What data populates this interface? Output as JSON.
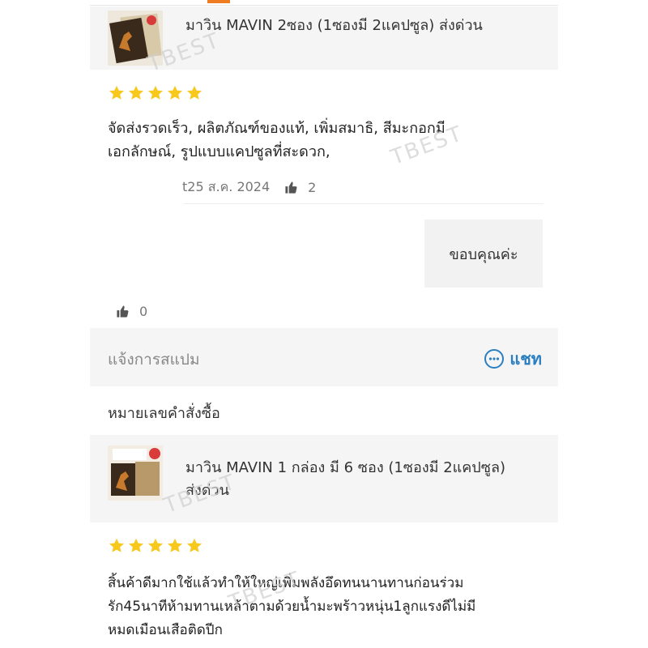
{
  "reviews": [
    {
      "product_title": "มาวิน MAVIN 2ซอง (1ซองมี 2แคปซูล) ส่งด่วน",
      "rating": 5,
      "text_lines": [
        "จัดส่งรวดเร็ว, ผลิตภัณฑ์ของแท้, เพิ่มสมาธิ, สีมะกอกมี",
        "เอกลักษณ์, รูปแบบแคปซูลที่สะดวก,"
      ],
      "date": "t25 ส.ค. 2024",
      "likes": "2",
      "seller_reply": "ขอบคุณค่ะ",
      "reply_likes": "0"
    },
    {
      "product_title_lines": [
        "มาวิน MAVIN 1 กล่อง มี 6 ซอง (1ซองมี 2แคปซูล)",
        "ส่งด่วน"
      ],
      "rating": 5,
      "text_lines": [
        "สิ้นค้าดีมากใช้แล้วทำให้ใหญ่เพิ่มพลังอึดทนนานทานก่อนร่วม",
        "รัก45นาทีห้ามทานเหล้าตามด้วยน้ำมะพร้าวหนุ่น1ลูกแรงดีไม่มี",
        "หมดเมือนเสือติดปีก"
      ]
    }
  ],
  "report_spam": "แจ้งการสแปม",
  "chat_label": "แชท",
  "order_number_label": "หมายเลขคำสั่งซื้อ",
  "watermark": "TBEST",
  "colors": {
    "accent": "#ee7d22",
    "star": "#f8c81c",
    "chat": "#2b7fc0"
  },
  "icons": [
    "star-icon",
    "thumbs-up-icon",
    "chat-bubble-icon"
  ]
}
